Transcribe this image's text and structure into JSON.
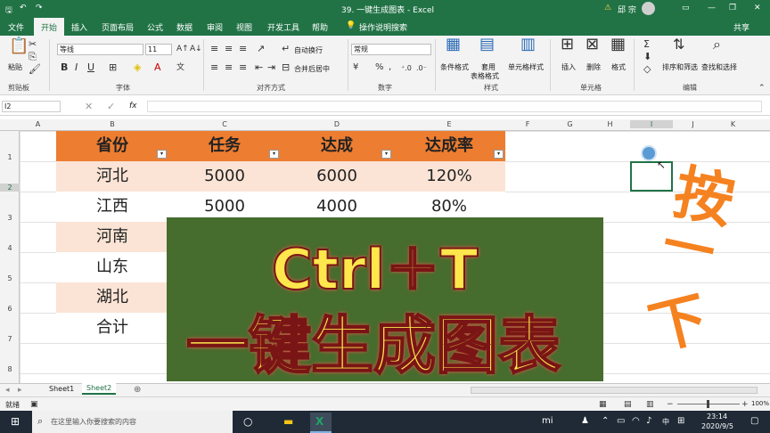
{
  "title_bar": {
    "doc_title": "39. 一键生成图表 - Excel",
    "user": "邱 宗",
    "warning_icon": "warning-icon",
    "user_avatar": "avatar"
  },
  "tabs": [
    "文件",
    "开始",
    "插入",
    "页面布局",
    "公式",
    "数据",
    "审阅",
    "视图",
    "开发工具",
    "帮助"
  ],
  "active_tab": "开始",
  "tell_me": "操作说明搜索",
  "share": "共享",
  "ribbon": {
    "paste": "粘贴",
    "clipboard": "剪贴板",
    "font_name": "等线",
    "font_size": "11",
    "font_group": "字体",
    "wrap_text": "自动换行",
    "merge_center": "合并后居中",
    "alignment_group": "对齐方式",
    "number_format": "常规",
    "number_group": "数字",
    "cond_format": "条件格式",
    "table_format_line1": "套用",
    "table_format_line2": "表格格式",
    "cell_styles": "单元格样式",
    "styles_group": "样式",
    "insert": "插入",
    "delete": "删除",
    "format": "格式",
    "cells_group": "单元格",
    "sort_filter": "排序和筛选",
    "find_select": "查找和选择",
    "editing_group": "编辑"
  },
  "formula_bar": {
    "name_box": "I2",
    "fx": "fx",
    "value": ""
  },
  "columns": [
    "A",
    "B",
    "C",
    "D",
    "E",
    "F",
    "G",
    "H",
    "I",
    "J",
    "K"
  ],
  "rows": [
    "1",
    "2",
    "3",
    "4",
    "5",
    "6",
    "7",
    "8"
  ],
  "table": {
    "headers": [
      "省份",
      "任务",
      "达成",
      "达成率"
    ],
    "rows": [
      [
        "河北",
        "5000",
        "6000",
        "120%"
      ],
      [
        "江西",
        "5000",
        "4000",
        "80%"
      ],
      [
        "河南",
        "",
        "",
        ""
      ],
      [
        "山东",
        "",
        "",
        ""
      ],
      [
        "湖北",
        "",
        "",
        ""
      ],
      [
        "合计",
        "",
        "",
        ""
      ]
    ],
    "header_color": "#ed7d31",
    "band_color": "#fbe4d5"
  },
  "overlay": {
    "line1": "Ctrl＋T",
    "line2": "一键生成图表",
    "bg_color": "#466d2e",
    "text_color": "#fde74c"
  },
  "side_text": [
    "按",
    "一",
    "下"
  ],
  "sheets": [
    "Sheet1",
    "Sheet2"
  ],
  "active_sheet": "Sheet2",
  "status": {
    "ready": "就绪",
    "zoom": "100%"
  },
  "taskbar": {
    "search_placeholder": "在这里输入你要搜索的内容",
    "ime": "中",
    "time": "23:14",
    "date": "2020/9/5"
  }
}
